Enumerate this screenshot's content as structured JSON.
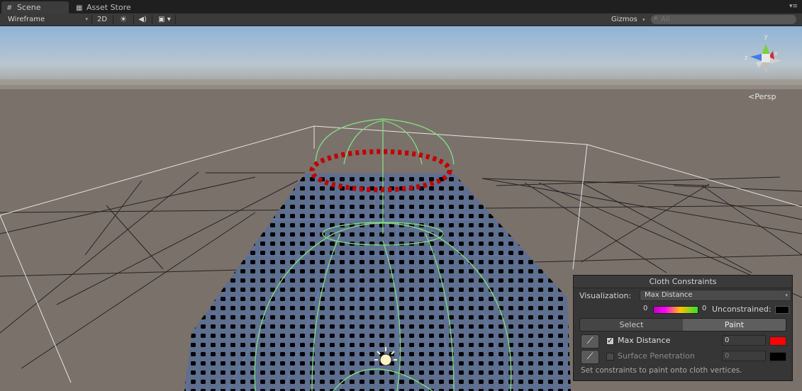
{
  "tabs": [
    {
      "label": "Scene",
      "icon": "grid-icon",
      "active": true
    },
    {
      "label": "Asset Store",
      "icon": "cart-icon",
      "active": false
    }
  ],
  "toolbar": {
    "shading_mode": "Wireframe",
    "btn_2d": "2D",
    "lighting_icon": "sun-icon",
    "audio_icon": "speaker-icon",
    "effects_icon": "image-icon",
    "gizmos": "Gizmos",
    "search_placeholder": "All"
  },
  "scene": {
    "projection_label": "Persp",
    "gizmo_axes": {
      "y": "y",
      "x": "x",
      "z": "z"
    }
  },
  "cloth_panel": {
    "title": "Cloth Constraints",
    "visualization_label": "Visualization:",
    "visualization_value": "Max Distance",
    "gradient_min": "0",
    "gradient_max": "0",
    "unconstrained_label": "Unconstrained:",
    "unconstrained_color": "#000000",
    "tabs": [
      "Select",
      "Paint"
    ],
    "active_tab": "Paint",
    "properties": [
      {
        "label": "Max Distance",
        "checked": true,
        "value": "0",
        "color": "#ff0000"
      },
      {
        "label": "Surface Penetration",
        "checked": false,
        "value": "0",
        "color": "#000000"
      }
    ],
    "hint": "Set constraints to paint onto cloth vertices."
  }
}
